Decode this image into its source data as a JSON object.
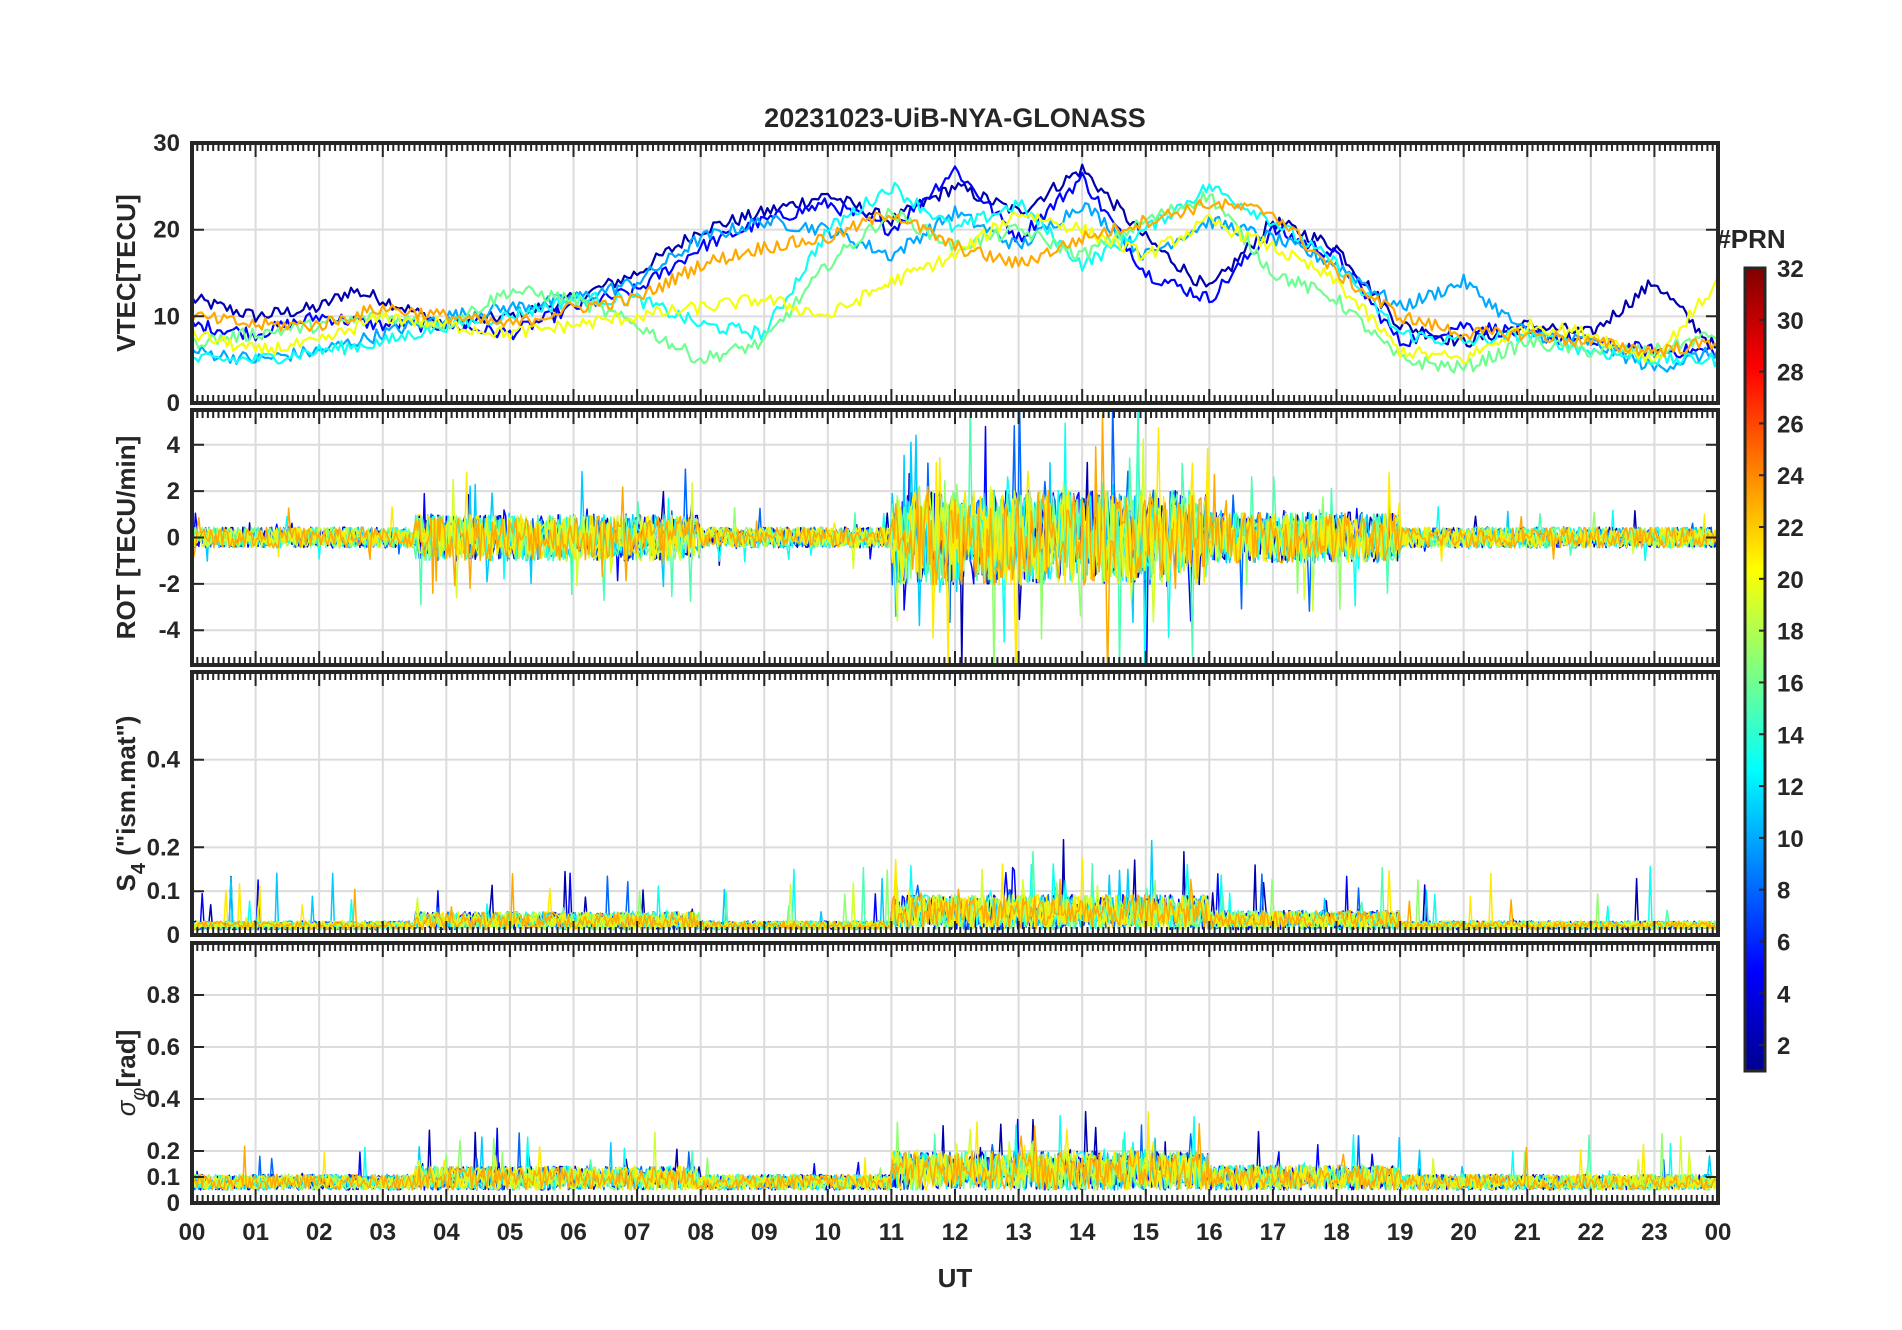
{
  "chart_data": {
    "type": "line",
    "title": "20231023-UiB-NYA-GLONASS",
    "xlabel": "UT",
    "x_ticks": [
      "00",
      "01",
      "02",
      "03",
      "04",
      "05",
      "06",
      "07",
      "08",
      "09",
      "10",
      "11",
      "12",
      "13",
      "14",
      "15",
      "16",
      "17",
      "18",
      "19",
      "20",
      "21",
      "22",
      "23",
      "00"
    ],
    "x_range_hours": [
      0,
      24
    ],
    "grid": true,
    "colorbar": {
      "label": "#PRN",
      "range": [
        1,
        32
      ],
      "ticks": [
        "32",
        "30",
        "28",
        "26",
        "24",
        "22",
        "20",
        "18",
        "16",
        "14",
        "12",
        "10",
        "8",
        "6",
        "4",
        "2"
      ],
      "colormap": [
        "#00008f",
        "#0000ff",
        "#0080ff",
        "#00ffff",
        "#80ff80",
        "#ffff00",
        "#ff8000",
        "#ff0000",
        "#800000"
      ]
    },
    "panels": [
      {
        "ylabel": "VTEC[TECU]",
        "ylim": [
          0,
          30
        ],
        "y_ticks": [
          "0",
          "10",
          "20",
          "30"
        ],
        "series": [
          {
            "prn": 2,
            "x": [
              0,
              1,
              2,
              2.5,
              3,
              4,
              5,
              6,
              7,
              8,
              9,
              10,
              11,
              12,
              13,
              14,
              15,
              16,
              17,
              18,
              19,
              20,
              21,
              22,
              23,
              24
            ],
            "y": [
              12,
              10,
              11,
              13,
              12,
              9,
              10,
              12,
              15,
              20,
              22,
              24,
              21,
              25,
              22,
              27,
              19,
              13,
              21,
              18,
              9,
              7,
              9,
              8,
              14,
              6
            ]
          },
          {
            "prn": 5,
            "x": [
              0,
              1,
              2,
              3,
              4,
              5,
              6,
              7,
              8,
              9,
              10,
              11,
              12,
              13,
              14,
              15,
              16,
              17,
              18,
              19,
              20,
              21,
              22,
              23,
              24
            ],
            "y": [
              9,
              8,
              10,
              9,
              9,
              8,
              11,
              13,
              18,
              21,
              23,
              20,
              27,
              19,
              26,
              15,
              12,
              20,
              17,
              7,
              9,
              8,
              7,
              6,
              6
            ]
          },
          {
            "prn": 10,
            "x": [
              0,
              1,
              2,
              3,
              4,
              5,
              6,
              7,
              8,
              9,
              10,
              11,
              12,
              13,
              14,
              15,
              16,
              17,
              18,
              19,
              20,
              21,
              22,
              23,
              24
            ],
            "y": [
              6,
              5,
              6,
              8,
              10,
              11,
              12,
              14,
              19,
              21,
              20,
              17,
              22,
              18,
              23,
              17,
              21,
              19,
              16,
              11,
              14,
              8,
              7,
              4,
              6
            ]
          },
          {
            "prn": 13,
            "x": [
              0,
              1,
              2,
              3,
              4,
              5,
              6,
              7,
              8,
              9,
              10,
              11,
              12,
              13,
              14,
              15,
              16,
              17,
              18,
              19,
              20,
              21,
              22,
              23,
              24
            ],
            "y": [
              5,
              5,
              6,
              7,
              9,
              10,
              12,
              12,
              9,
              8,
              20,
              25,
              20,
              23,
              16,
              20,
              25,
              21,
              16,
              8,
              7,
              8,
              6,
              5,
              5
            ]
          },
          {
            "prn": 16,
            "x": [
              0,
              1,
              2,
              3,
              4,
              5,
              6,
              7,
              8,
              9,
              10,
              11,
              12,
              13,
              14,
              15,
              16,
              17,
              18,
              19,
              20,
              21,
              22,
              23,
              24
            ],
            "y": [
              7,
              8,
              9,
              10,
              9,
              13,
              12,
              9,
              5,
              7,
              16,
              22,
              18,
              20,
              17,
              21,
              24,
              15,
              12,
              5,
              4,
              7,
              6,
              6,
              8
            ]
          },
          {
            "prn": 20,
            "x": [
              0,
              1,
              2,
              3,
              4,
              5,
              6,
              7,
              8,
              9,
              10,
              11,
              12,
              13,
              14,
              15,
              16,
              17,
              18,
              19,
              20,
              21,
              22,
              23,
              24
            ],
            "y": [
              8,
              6,
              7,
              10,
              9,
              8,
              9,
              10,
              11,
              12,
              10,
              14,
              17,
              22,
              20,
              17,
              21,
              18,
              14,
              6,
              5,
              9,
              8,
              5,
              14
            ]
          },
          {
            "prn": 23,
            "x": [
              0,
              1,
              2,
              3,
              4,
              5,
              6,
              7,
              8,
              9,
              10,
              11,
              12,
              13,
              14,
              15,
              16,
              17,
              18,
              19,
              20,
              21,
              22,
              23,
              24
            ],
            "y": [
              10,
              9,
              9,
              11,
              10,
              9,
              11,
              12,
              16,
              18,
              19,
              22,
              18,
              16,
              19,
              21,
              23,
              22,
              15,
              10,
              8,
              8,
              7,
              6,
              7
            ]
          }
        ]
      },
      {
        "ylabel": "ROT [TECU/min]",
        "ylim": [
          -5.5,
          5.5
        ],
        "y_ticks": [
          "-4",
          "-2",
          "0",
          "2",
          "4"
        ]
      },
      {
        "ylabel": "S4 (\"ism.mat\")",
        "ylabel_parts": [
          "S",
          "4",
          "  (\"ism.mat\")"
        ],
        "ylim": [
          0,
          0.6
        ],
        "y_ticks": [
          "0",
          "0.1",
          "0.2",
          "0.4"
        ]
      },
      {
        "ylabel": "σφ[rad]",
        "ylabel_parts": [
          "σ",
          "φ",
          "[rad]"
        ],
        "ylim": [
          0,
          1
        ],
        "y_ticks": [
          "0",
          "0.1",
          "0.2",
          "0.4",
          "0.6",
          "0.8"
        ]
      }
    ]
  }
}
